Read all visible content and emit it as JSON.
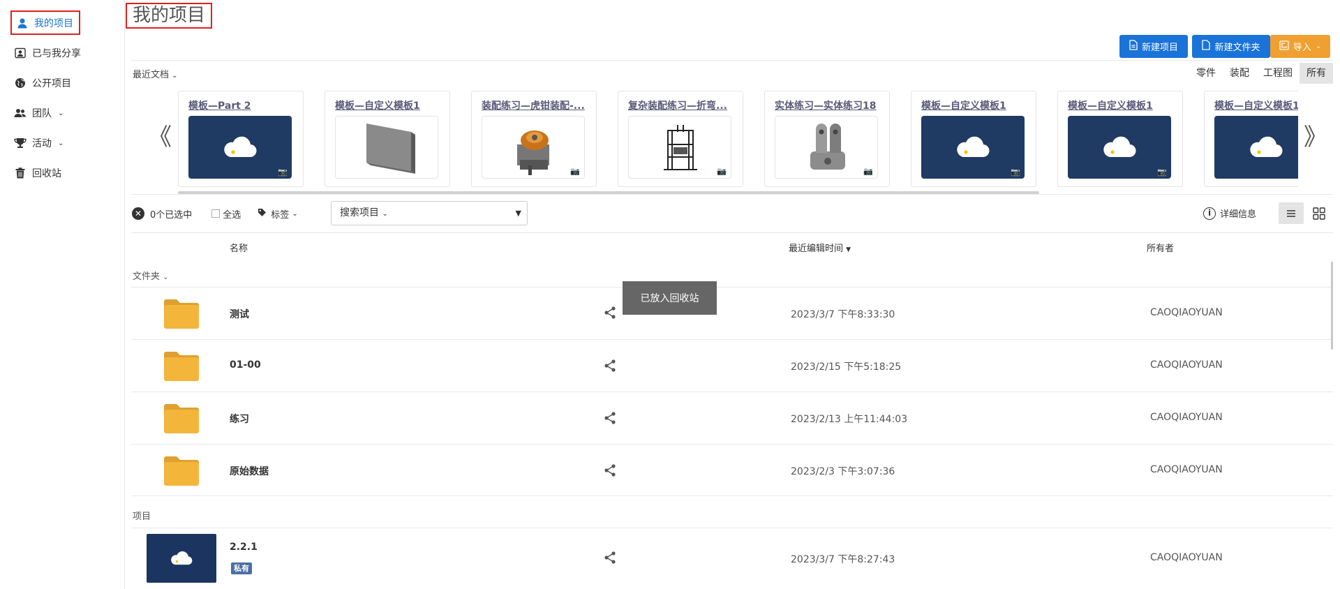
{
  "sidebar": {
    "items": [
      {
        "label": "我的项目",
        "caret": ""
      },
      {
        "label": "已与我分享",
        "caret": ""
      },
      {
        "label": "公开项目",
        "caret": ""
      },
      {
        "label": "团队",
        "caret": "⌄"
      },
      {
        "label": "活动",
        "caret": "⌄"
      },
      {
        "label": "回收站",
        "caret": ""
      }
    ]
  },
  "header": {
    "title": "我的项目",
    "new_project": "新建项目",
    "new_folder": "新建文件夹",
    "import": "导入"
  },
  "recent": {
    "label": "最近文档",
    "filters": [
      "零件",
      "装配",
      "工程图",
      "所有"
    ],
    "active_filter": "所有",
    "cards": [
      {
        "title": "模板—Part 2",
        "thumb": "cloud"
      },
      {
        "title": "模板—自定义模板1",
        "thumb": "plate"
      },
      {
        "title": "装配练习—虎钳装配-...",
        "thumb": "vise"
      },
      {
        "title": "复杂装配练习—折弯...",
        "thumb": "frame"
      },
      {
        "title": "实体练习—实体练习18",
        "thumb": "bracket"
      },
      {
        "title": "模板—自定义模板1",
        "thumb": "cloud"
      },
      {
        "title": "模板—自定义模板1",
        "thumb": "cloud"
      },
      {
        "title": "模板—自定义模板1",
        "thumb": "cloud"
      }
    ]
  },
  "toolbar": {
    "selected": "0个已选中",
    "select_all": "全选",
    "tags": "标签",
    "search_label": "搜索项目",
    "details": "详细信息"
  },
  "table": {
    "col_name": "名称",
    "col_time": "最近编辑时间",
    "col_owner": "所有者",
    "folders_label": "文件夹",
    "projects_label": "项目",
    "folders": [
      {
        "name": "测试",
        "date": "2023/3/7 下午8:33:30",
        "owner": "CAOQIAOYUAN"
      },
      {
        "name": "01-00",
        "date": "2023/2/15 下午5:18:25",
        "owner": "CAOQIAOYUAN"
      },
      {
        "name": "练习",
        "date": "2023/2/13 上午11:44:03",
        "owner": "CAOQIAOYUAN"
      },
      {
        "name": "原始数据",
        "date": "2023/2/3 下午3:07:36",
        "owner": "CAOQIAOYUAN"
      }
    ],
    "projects": [
      {
        "name": "2.2.1",
        "badge": "私有",
        "date": "2023/3/7 下午8:27:43",
        "owner": "CAOQIAOYUAN"
      }
    ]
  },
  "toast": "已放入回收站",
  "colors": {
    "primary": "#1a73d9",
    "import": "#f0a030",
    "highlight": "#e02020",
    "folder": "#f3b53a"
  }
}
